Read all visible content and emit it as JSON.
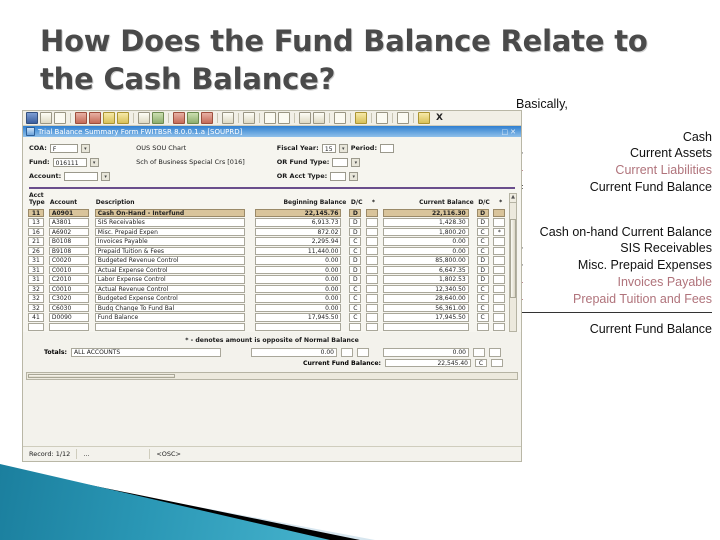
{
  "slide": {
    "title": "How Does the Fund Balance Relate to the Cash Balance?"
  },
  "explain": {
    "intro": "Basically,",
    "equation_top": [
      {
        "op": "",
        "term": "Cash"
      },
      {
        "op": "+",
        "term": "Current Assets"
      },
      {
        "op": "–",
        "term": "Current Liabilities",
        "negative": true
      },
      {
        "op": "=",
        "term": "Current Fund Balance"
      }
    ],
    "equation_detail": [
      {
        "op": "",
        "term": "Cash on-hand Current Balance"
      },
      {
        "op": "+",
        "term": "SIS Receivables"
      },
      {
        "op": "+",
        "term": "Misc. Prepaid Expenses"
      },
      {
        "op": "–",
        "term": "Invoices Payable",
        "negative": true
      },
      {
        "op": "–",
        "term": "Prepaid Tuition and Fees",
        "negative": true
      }
    ],
    "result": "Current Fund Balance",
    "negative_color": "#b0737b"
  },
  "app": {
    "toolbar": {
      "close_label": "X",
      "icons": [
        "save-icon",
        "rollback-icon",
        "page-icon",
        "select-icon",
        "insert-record-icon",
        "remove-record-icon",
        "duplicate-record-icon",
        "query-enter-icon",
        "query-execute-icon",
        "cancel-query-icon",
        "previous-block-icon",
        "next-block-icon",
        "previous-record-icon",
        "next-record-icon",
        "print-icon",
        "list-values-icon",
        "edit-icon",
        "insert-icon",
        "remove-icon",
        "sound-icon",
        "online-help-icon",
        "calendar-icon",
        "calculator-icon",
        "hint-icon"
      ]
    },
    "window_title": "Trial Balance Summary Form  FWITBSR  8.0.0.1.a  [SOUPRD]",
    "header_fields": [
      {
        "label": "COA:",
        "value": "F",
        "description": "OUS SOU Chart"
      },
      {
        "label": "Fund:",
        "value": "016111",
        "description": "Sch of Business Special Crs [016]"
      },
      {
        "label": "Account:",
        "value": "",
        "description": ""
      }
    ],
    "header_fields_right": [
      {
        "label": "Fiscal Year:",
        "value": "15",
        "extra_label": "Period:",
        "extra_value": ""
      },
      {
        "label": "OR Fund Type:",
        "value": ""
      },
      {
        "label": "OR Acct Type:",
        "value": ""
      }
    ],
    "columns": [
      "Acct Type",
      "Account",
      "Description",
      "Beginning Balance",
      "D/C",
      "*",
      "Current Balance",
      "D/C",
      "*"
    ],
    "rows": [
      {
        "acct_type": "11",
        "account": "A0901",
        "description": "Cash On-Hand - Interfund",
        "beginning": "22,145.76",
        "bdc": "D",
        "bstar": "",
        "current": "22,116.30",
        "cdc": "D",
        "cstar": "",
        "selected": true
      },
      {
        "acct_type": "13",
        "account": "A3801",
        "description": "SIS Receivables",
        "beginning": "6,913.73",
        "bdc": "D",
        "bstar": "",
        "current": "1,428.30",
        "cdc": "D",
        "cstar": ""
      },
      {
        "acct_type": "16",
        "account": "A6902",
        "description": "Misc. Prepaid Expen",
        "beginning": "872.02",
        "bdc": "D",
        "bstar": "",
        "current": "1,800.20",
        "cdc": "C",
        "cstar": "*"
      },
      {
        "acct_type": "21",
        "account": "B0108",
        "description": "Invoices Payable",
        "beginning": "2,295.94",
        "bdc": "C",
        "bstar": "",
        "current": "0.00",
        "cdc": "C",
        "cstar": ""
      },
      {
        "acct_type": "26",
        "account": "B9108",
        "description": "Prepaid Tuition & Fees",
        "beginning": "11,440.00",
        "bdc": "C",
        "bstar": "",
        "current": "0.00",
        "cdc": "C",
        "cstar": ""
      },
      {
        "acct_type": "31",
        "account": "C0020",
        "description": "Budgeted Revenue Control",
        "beginning": "0.00",
        "bdc": "D",
        "bstar": "",
        "current": "85,800.00",
        "cdc": "D",
        "cstar": ""
      },
      {
        "acct_type": "31",
        "account": "C0010",
        "description": "Actual Expense Control",
        "beginning": "0.00",
        "bdc": "D",
        "bstar": "",
        "current": "6,647.35",
        "cdc": "D",
        "cstar": ""
      },
      {
        "acct_type": "31",
        "account": "C2010",
        "description": "Labor Expense Control",
        "beginning": "0.00",
        "bdc": "D",
        "bstar": "",
        "current": "1,802.53",
        "cdc": "D",
        "cstar": ""
      },
      {
        "acct_type": "32",
        "account": "C0010",
        "description": "Actual Revenue Control",
        "beginning": "0.00",
        "bdc": "C",
        "bstar": "",
        "current": "12,340.50",
        "cdc": "C",
        "cstar": ""
      },
      {
        "acct_type": "32",
        "account": "C3020",
        "description": "Budgeted Expense Control",
        "beginning": "0.00",
        "bdc": "C",
        "bstar": "",
        "current": "28,640.00",
        "cdc": "C",
        "cstar": ""
      },
      {
        "acct_type": "32",
        "account": "C6030",
        "description": "Budg Change To Fund Bal",
        "beginning": "0.00",
        "bdc": "C",
        "bstar": "",
        "current": "56,361.00",
        "cdc": "C",
        "cstar": ""
      },
      {
        "acct_type": "41",
        "account": "D0090",
        "description": "Fund Balance",
        "beginning": "17,945.50",
        "bdc": "C",
        "bstar": "",
        "current": "17,945.50",
        "cdc": "C",
        "cstar": ""
      },
      {
        "acct_type": "",
        "account": "",
        "description": "",
        "beginning": "",
        "bdc": "",
        "bstar": "",
        "current": "",
        "cdc": "",
        "cstar": ""
      }
    ],
    "footnote": "* - denotes amount is opposite of Normal Balance",
    "totals": {
      "label": "Totals:",
      "scope": "ALL ACCOUNTS",
      "beginning": "0.00",
      "bdc": "",
      "bstar": "",
      "current": "0.00",
      "cdc": "",
      "cstar": ""
    },
    "current_fund_balance": {
      "label": "Current Fund Balance:",
      "value": "22,545.40",
      "dc": "C",
      "star": ""
    },
    "status": {
      "record": "Record: 1/12",
      "mid": "...",
      "mode": "<OSC>"
    }
  }
}
